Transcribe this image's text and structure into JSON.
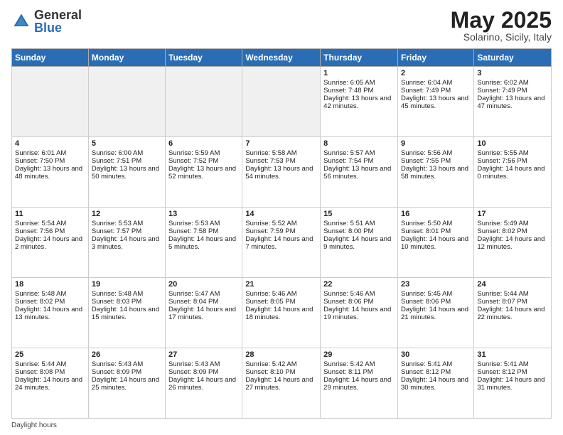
{
  "header": {
    "logo_general": "General",
    "logo_blue": "Blue",
    "month_title": "May 2025",
    "subtitle": "Solarino, Sicily, Italy"
  },
  "days_of_week": [
    "Sunday",
    "Monday",
    "Tuesday",
    "Wednesday",
    "Thursday",
    "Friday",
    "Saturday"
  ],
  "weeks": [
    [
      {
        "day": "",
        "empty": true
      },
      {
        "day": "",
        "empty": true
      },
      {
        "day": "",
        "empty": true
      },
      {
        "day": "",
        "empty": true
      },
      {
        "day": "1",
        "sunrise": "Sunrise: 6:05 AM",
        "sunset": "Sunset: 7:48 PM",
        "daylight": "Daylight: 13 hours and 42 minutes."
      },
      {
        "day": "2",
        "sunrise": "Sunrise: 6:04 AM",
        "sunset": "Sunset: 7:49 PM",
        "daylight": "Daylight: 13 hours and 45 minutes."
      },
      {
        "day": "3",
        "sunrise": "Sunrise: 6:02 AM",
        "sunset": "Sunset: 7:49 PM",
        "daylight": "Daylight: 13 hours and 47 minutes."
      }
    ],
    [
      {
        "day": "4",
        "sunrise": "Sunrise: 6:01 AM",
        "sunset": "Sunset: 7:50 PM",
        "daylight": "Daylight: 13 hours and 48 minutes."
      },
      {
        "day": "5",
        "sunrise": "Sunrise: 6:00 AM",
        "sunset": "Sunset: 7:51 PM",
        "daylight": "Daylight: 13 hours and 50 minutes."
      },
      {
        "day": "6",
        "sunrise": "Sunrise: 5:59 AM",
        "sunset": "Sunset: 7:52 PM",
        "daylight": "Daylight: 13 hours and 52 minutes."
      },
      {
        "day": "7",
        "sunrise": "Sunrise: 5:58 AM",
        "sunset": "Sunset: 7:53 PM",
        "daylight": "Daylight: 13 hours and 54 minutes."
      },
      {
        "day": "8",
        "sunrise": "Sunrise: 5:57 AM",
        "sunset": "Sunset: 7:54 PM",
        "daylight": "Daylight: 13 hours and 56 minutes."
      },
      {
        "day": "9",
        "sunrise": "Sunrise: 5:56 AM",
        "sunset": "Sunset: 7:55 PM",
        "daylight": "Daylight: 13 hours and 58 minutes."
      },
      {
        "day": "10",
        "sunrise": "Sunrise: 5:55 AM",
        "sunset": "Sunset: 7:56 PM",
        "daylight": "Daylight: 14 hours and 0 minutes."
      }
    ],
    [
      {
        "day": "11",
        "sunrise": "Sunrise: 5:54 AM",
        "sunset": "Sunset: 7:56 PM",
        "daylight": "Daylight: 14 hours and 2 minutes."
      },
      {
        "day": "12",
        "sunrise": "Sunrise: 5:53 AM",
        "sunset": "Sunset: 7:57 PM",
        "daylight": "Daylight: 14 hours and 3 minutes."
      },
      {
        "day": "13",
        "sunrise": "Sunrise: 5:53 AM",
        "sunset": "Sunset: 7:58 PM",
        "daylight": "Daylight: 14 hours and 5 minutes."
      },
      {
        "day": "14",
        "sunrise": "Sunrise: 5:52 AM",
        "sunset": "Sunset: 7:59 PM",
        "daylight": "Daylight: 14 hours and 7 minutes."
      },
      {
        "day": "15",
        "sunrise": "Sunrise: 5:51 AM",
        "sunset": "Sunset: 8:00 PM",
        "daylight": "Daylight: 14 hours and 9 minutes."
      },
      {
        "day": "16",
        "sunrise": "Sunrise: 5:50 AM",
        "sunset": "Sunset: 8:01 PM",
        "daylight": "Daylight: 14 hours and 10 minutes."
      },
      {
        "day": "17",
        "sunrise": "Sunrise: 5:49 AM",
        "sunset": "Sunset: 8:02 PM",
        "daylight": "Daylight: 14 hours and 12 minutes."
      }
    ],
    [
      {
        "day": "18",
        "sunrise": "Sunrise: 5:48 AM",
        "sunset": "Sunset: 8:02 PM",
        "daylight": "Daylight: 14 hours and 13 minutes."
      },
      {
        "day": "19",
        "sunrise": "Sunrise: 5:48 AM",
        "sunset": "Sunset: 8:03 PM",
        "daylight": "Daylight: 14 hours and 15 minutes."
      },
      {
        "day": "20",
        "sunrise": "Sunrise: 5:47 AM",
        "sunset": "Sunset: 8:04 PM",
        "daylight": "Daylight: 14 hours and 17 minutes."
      },
      {
        "day": "21",
        "sunrise": "Sunrise: 5:46 AM",
        "sunset": "Sunset: 8:05 PM",
        "daylight": "Daylight: 14 hours and 18 minutes."
      },
      {
        "day": "22",
        "sunrise": "Sunrise: 5:46 AM",
        "sunset": "Sunset: 8:06 PM",
        "daylight": "Daylight: 14 hours and 19 minutes."
      },
      {
        "day": "23",
        "sunrise": "Sunrise: 5:45 AM",
        "sunset": "Sunset: 8:06 PM",
        "daylight": "Daylight: 14 hours and 21 minutes."
      },
      {
        "day": "24",
        "sunrise": "Sunrise: 5:44 AM",
        "sunset": "Sunset: 8:07 PM",
        "daylight": "Daylight: 14 hours and 22 minutes."
      }
    ],
    [
      {
        "day": "25",
        "sunrise": "Sunrise: 5:44 AM",
        "sunset": "Sunset: 8:08 PM",
        "daylight": "Daylight: 14 hours and 24 minutes."
      },
      {
        "day": "26",
        "sunrise": "Sunrise: 5:43 AM",
        "sunset": "Sunset: 8:09 PM",
        "daylight": "Daylight: 14 hours and 25 minutes."
      },
      {
        "day": "27",
        "sunrise": "Sunrise: 5:43 AM",
        "sunset": "Sunset: 8:09 PM",
        "daylight": "Daylight: 14 hours and 26 minutes."
      },
      {
        "day": "28",
        "sunrise": "Sunrise: 5:42 AM",
        "sunset": "Sunset: 8:10 PM",
        "daylight": "Daylight: 14 hours and 27 minutes."
      },
      {
        "day": "29",
        "sunrise": "Sunrise: 5:42 AM",
        "sunset": "Sunset: 8:11 PM",
        "daylight": "Daylight: 14 hours and 29 minutes."
      },
      {
        "day": "30",
        "sunrise": "Sunrise: 5:41 AM",
        "sunset": "Sunset: 8:12 PM",
        "daylight": "Daylight: 14 hours and 30 minutes."
      },
      {
        "day": "31",
        "sunrise": "Sunrise: 5:41 AM",
        "sunset": "Sunset: 8:12 PM",
        "daylight": "Daylight: 14 hours and 31 minutes."
      }
    ]
  ],
  "footer": {
    "note": "Daylight hours"
  }
}
